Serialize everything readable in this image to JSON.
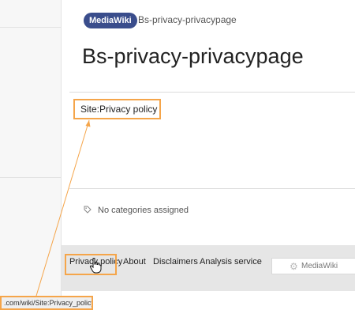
{
  "header": {
    "badge": "MediaWiki",
    "breadcrumb": "Bs-privacy-privacypage"
  },
  "page": {
    "title": "Bs-privacy-privacypage",
    "content_link": "Site:Privacy policy"
  },
  "categories": {
    "text": "No categories assigned",
    "icon": "tag-icon"
  },
  "footer": {
    "links": [
      "Privacy policy",
      "About",
      "Disclaimers",
      "Analysis service"
    ],
    "powered_by": "MediaWiki",
    "powered_by_icon": "gear-icon"
  },
  "status_bar": {
    "url": ".com/wiki/Site:Privacy_policy"
  },
  "annotation_color": "#f5a54a"
}
